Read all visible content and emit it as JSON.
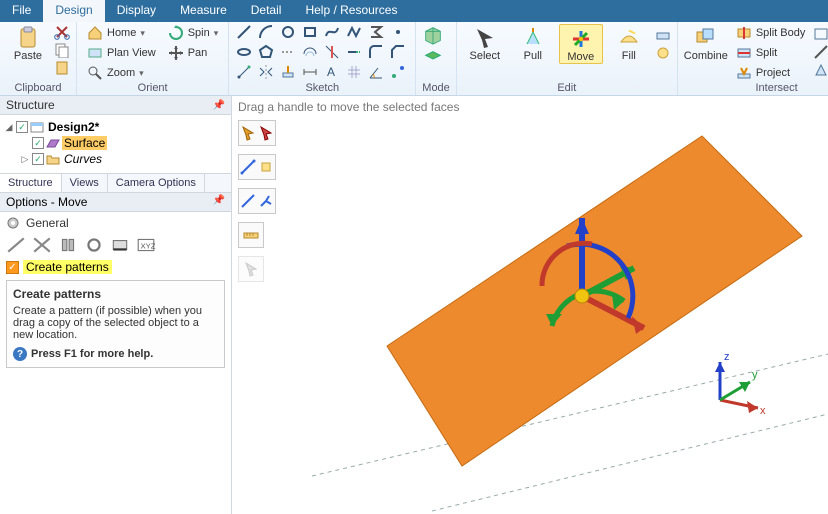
{
  "menu": {
    "items": [
      "File",
      "Design",
      "Display",
      "Measure",
      "Detail",
      "Help / Resources"
    ],
    "active": "Design"
  },
  "ribbon": {
    "clipboard": {
      "title": "Clipboard",
      "paste": "Paste"
    },
    "orient": {
      "title": "Orient",
      "home": "Home",
      "spin": "Spin",
      "planview": "Plan View",
      "pan": "Pan",
      "zoom": "Zoom"
    },
    "sketch": {
      "title": "Sketch"
    },
    "mode": {
      "title": "Mode"
    },
    "edit": {
      "title": "Edit",
      "select": "Select",
      "pull": "Pull",
      "move": "Move",
      "fill": "Fill"
    },
    "intersect": {
      "title": "Intersect",
      "combine": "Combine",
      "splitbody": "Split Body",
      "split": "Split",
      "project": "Project"
    }
  },
  "structure": {
    "title": "Structure",
    "root": "Design2*",
    "surface": "Surface",
    "curves": "Curves",
    "tabs": [
      "Structure",
      "Views",
      "Camera Options"
    ]
  },
  "options": {
    "title": "Options - Move",
    "general": "General",
    "checkbox_label": "Create patterns",
    "tip_title": "Create patterns",
    "tip_body": "Create a pattern (if possible) when you drag a copy of the selected object to a new location.",
    "help": "Press F1 for more help."
  },
  "viewport": {
    "hint": "Drag a handle to move the selected faces",
    "axes": {
      "x": "x",
      "y": "y",
      "z": "z"
    }
  }
}
